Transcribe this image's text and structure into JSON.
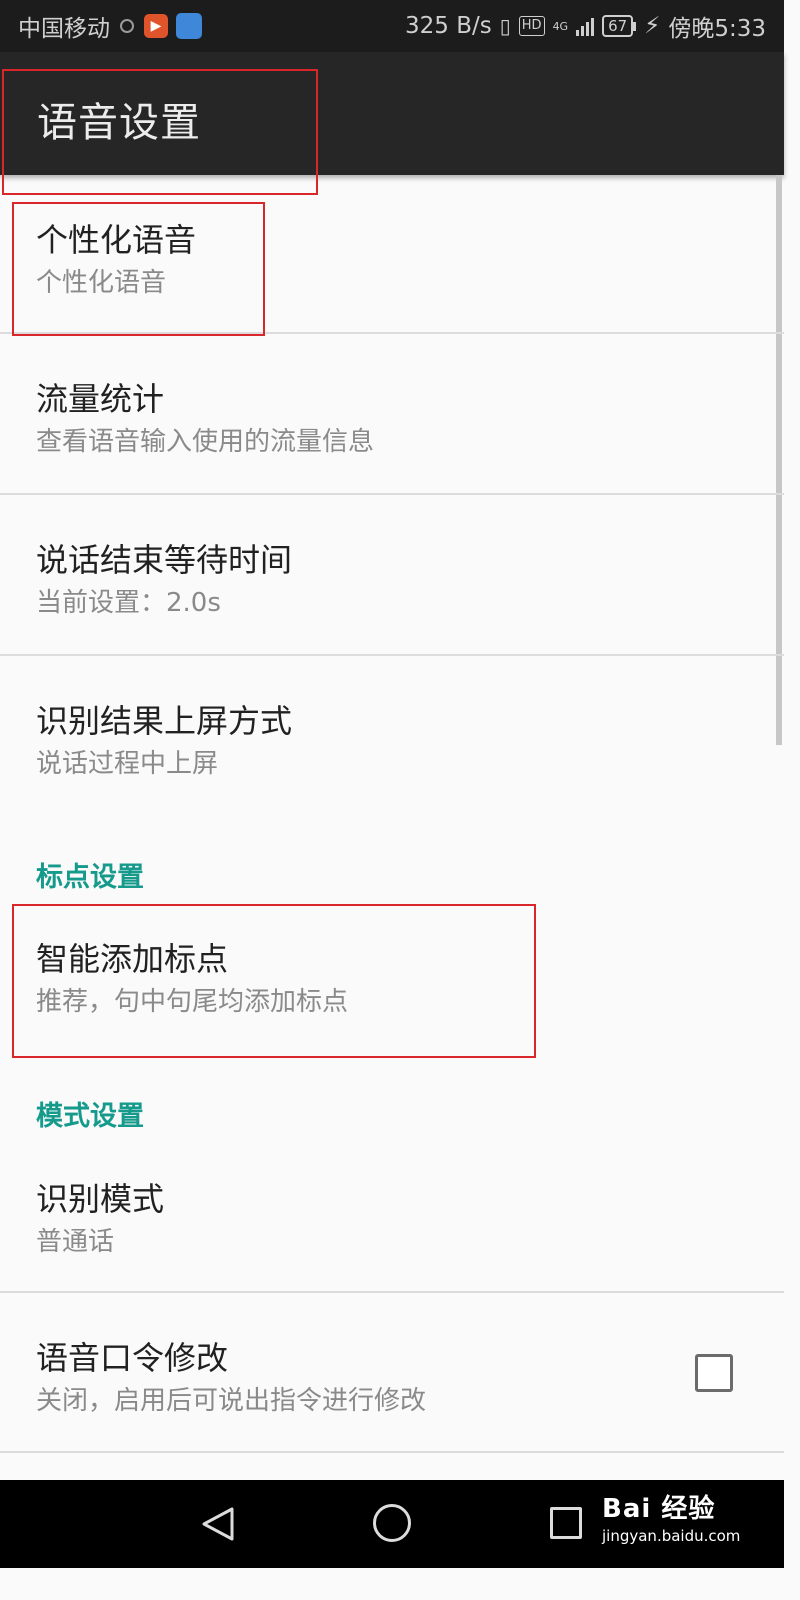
{
  "status_bar": {
    "carrier": "中国移动",
    "speed": "325 B/s",
    "hd": "HD",
    "network": "4G",
    "battery": "67",
    "time": "傍晚5:33"
  },
  "toolbar": {
    "title": "语音设置"
  },
  "items": [
    {
      "title": "个性化语音",
      "subtitle": "个性化语音"
    },
    {
      "title": "流量统计",
      "subtitle": "查看语音输入使用的流量信息"
    },
    {
      "title": "说话结束等待时间",
      "subtitle": "当前设置：2.0s"
    },
    {
      "title": "识别结果上屏方式",
      "subtitle": "说话过程中上屏"
    },
    {
      "title": "智能添加标点",
      "subtitle": "推荐，句中句尾均添加标点"
    },
    {
      "title": "识别模式",
      "subtitle": "普通话"
    },
    {
      "title": "语音口令修改",
      "subtitle": "关闭，启用后可说出指令进行修改",
      "checked": false
    }
  ],
  "sections": {
    "punctuation": "标点设置",
    "mode": "模式设置"
  },
  "watermark": {
    "brand": "Bai 经验",
    "url": "jingyan.baidu.com"
  },
  "colors": {
    "accent": "#159a8c",
    "highlight": "#d9262b",
    "toolbar": "#262626"
  }
}
